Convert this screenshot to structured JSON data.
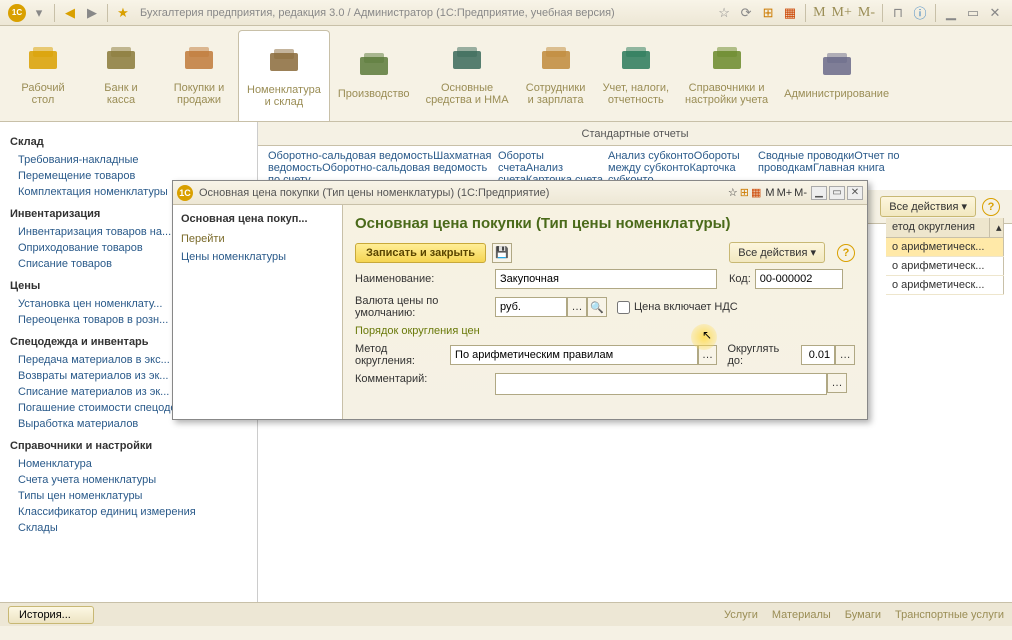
{
  "titlebar": {
    "title": "Бухгалтерия предприятия, редакция 3.0 / Администратор  (1С:Предприятие, учебная версия)",
    "mem_labels": [
      "M",
      "M+",
      "M-"
    ]
  },
  "toolbar": {
    "items": [
      {
        "label": "Рабочий\nстол"
      },
      {
        "label": "Банк и\nкасса"
      },
      {
        "label": "Покупки и\nпродажи"
      },
      {
        "label": "Номенклатура\nи склад"
      },
      {
        "label": "Производство"
      },
      {
        "label": "Основные\nсредства и НМА"
      },
      {
        "label": "Сотрудники\nи зарплата"
      },
      {
        "label": "Учет, налоги,\nотчетность"
      },
      {
        "label": "Справочники и\nнастройки учета"
      },
      {
        "label": "Администрирование"
      }
    ]
  },
  "sidebar": {
    "groups": [
      {
        "title": "Склад",
        "items": [
          "Требования-накладные",
          "Перемещение товаров",
          "Комплектация номенклатуры"
        ]
      },
      {
        "title": "Инвентаризация",
        "items": [
          "Инвентаризация товаров на...",
          "Оприходование товаров",
          "Списание товаров"
        ]
      },
      {
        "title": "Цены",
        "items": [
          "Установка цен номенклату...",
          "Переоценка товаров в розн..."
        ]
      },
      {
        "title": "Спецодежда и инвентарь",
        "items": [
          "Передача материалов в экс...",
          "Возвраты материалов из эк...",
          "Списание материалов из эк...",
          "Погашение стоимости спецодежды...",
          "Выработка материалов"
        ]
      },
      {
        "title": "Справочники и настройки",
        "items": [
          "Номенклатура",
          "Счета учета номенклатуры",
          "Типы цен номенклатуры",
          "Классификатор единиц измерения",
          "Склады"
        ]
      }
    ]
  },
  "sub_header": "Стандартные отчеты",
  "sub_cols": [
    [
      "Оборотно-сальдовая ведомость",
      "Шахматная ведомость",
      "Оборотно-сальдовая ведомость по счету"
    ],
    [
      "Обороты счета",
      "Анализ счета",
      "Карточка счета"
    ],
    [
      "Анализ субконто",
      "Обороты между субконто",
      "Карточка субконто"
    ],
    [
      "Сводные проводки",
      "Отчет по проводкам",
      "Главная книга"
    ]
  ],
  "main_top": {
    "actions": "Все действия",
    "grid_cols": [
      "етод округления"
    ],
    "grid_rows": [
      "о арифметическ...",
      "о арифметическ...",
      "о арифметическ..."
    ]
  },
  "dialog": {
    "title": "Основная цена покупки (Тип цены номенклатуры)  (1С:Предприятие)",
    "nav_head": "Основная цена покуп...",
    "nav_group": "Перейти",
    "nav_links": [
      "Цены номенклатуры"
    ],
    "header": "Основная цена покупки (Тип цены номенклатуры)",
    "save": "Записать и закрыть",
    "actions": "Все действия",
    "lbl_name": "Наименование:",
    "val_name": "Закупочная",
    "lbl_code": "Код:",
    "val_code": "00-000002",
    "lbl_currency": "Валюта цены по умолчанию:",
    "val_currency": "руб.",
    "chk_vat": "Цена включает НДС",
    "rounding_header": "Порядок округления цен",
    "lbl_method": "Метод округления:",
    "val_method": "По арифметическим правилам",
    "lbl_roundto": "Округлять до:",
    "val_roundto": "0.01",
    "lbl_comment": "Комментарий:",
    "val_comment": ""
  },
  "statusbar": {
    "history": "История...",
    "links": [
      "Услуги",
      "Материалы",
      "Бумаги",
      "Транспортные услуги"
    ]
  }
}
